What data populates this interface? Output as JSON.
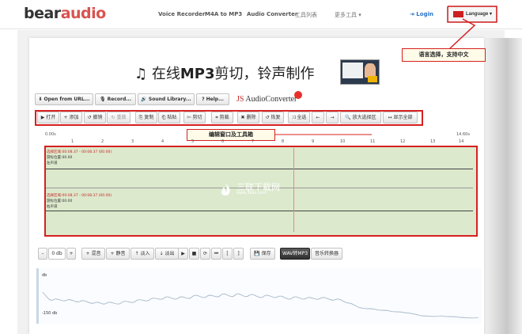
{
  "nav": {
    "logo_part1": "bear",
    "logo_part2": "audio",
    "links": [
      "Voice Recorder",
      "M4A to MP3",
      "Audio Converter",
      "工具列表",
      "更多工具 ▾"
    ],
    "login": "⇥ Login",
    "language": "Language ▾"
  },
  "callouts": {
    "language": "语言选择，支持中文",
    "editor": "编辑窗口及工具箱"
  },
  "title": {
    "icon": "♫",
    "text_pre": " 在线",
    "text_bold": "MP3",
    "text_post": "剪切，铃声制作"
  },
  "actions": [
    {
      "id": "open-url",
      "label": "⬇ Open from URL..."
    },
    {
      "id": "record",
      "label": "🎙 Record..."
    },
    {
      "id": "sound-library",
      "label": "🔊 Sound Library..."
    },
    {
      "id": "help",
      "label": "? Help..."
    }
  ],
  "js_logo": {
    "js": "JS ",
    "ac": "AudioConverter"
  },
  "toolbar": [
    "▶ 打开",
    "+ 添加",
    "↺ 撤销",
    "↻ 重做",
    "⎘ 复制",
    "⎗ 粘贴",
    "✄ 剪切",
    "⌗ 剪裁",
    "✖ 删除",
    "↺ 恢复",
    "⤨ 全选",
    "←",
    "→",
    "🔍 放大选择区",
    "↔ 显示全部"
  ],
  "ruler": {
    "labels": [
      "0.00s",
      "1",
      "2",
      "3",
      "4",
      "5",
      "6",
      "7",
      "8",
      "9",
      "10",
      "11",
      "12",
      "13",
      "14",
      "14.60s"
    ]
  },
  "tracks": [
    {
      "selection": "选择区域:00:08.37 - 00:08.37 (00.00)",
      "cursor": "游标位置:00.00",
      "channel": "左声道"
    },
    {
      "selection": "选择区域:00:08.37 - 00:08.37 (00.00)",
      "cursor": "游标位置:00.00",
      "channel": "右声道"
    }
  ],
  "watermark": {
    "title": "三联下载网",
    "url": "www.3lian.com"
  },
  "effects": [
    "–",
    "0 db",
    "+",
    "+ 混音",
    "+ 静音",
    "↑ 淡入",
    "↓ 淡出"
  ],
  "transport": {
    "play": "▶",
    "stop": "■",
    "loop": "⟳",
    "rewind": "⏮",
    "bracket_left": "[",
    "bracket_right": "]",
    "save": "💾 保存",
    "wav_mp3": "WAV转MP3",
    "convert": "音乐转换器"
  },
  "spectrum": {
    "top_label": "db",
    "bottom_label": "-150 db"
  }
}
